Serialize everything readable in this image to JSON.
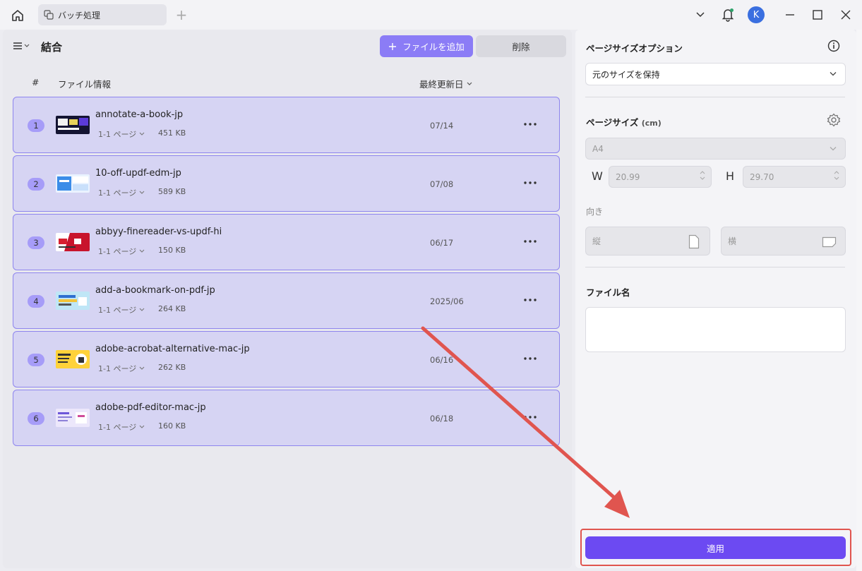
{
  "titlebar": {
    "tab_label": "バッチ処理",
    "avatar_letter": "K"
  },
  "left": {
    "title": "結合",
    "add_file_label": "ファイルを追加",
    "delete_label": "削除",
    "columns": {
      "num": "#",
      "info": "ファイル情報",
      "date": "最終更新日"
    },
    "files": [
      {
        "num": "1",
        "name": "annotate-a-book-jp",
        "pages": "1-1 ページ",
        "size": "451 KB",
        "date": "07/14"
      },
      {
        "num": "2",
        "name": "10-off-updf-edm-jp",
        "pages": "1-1 ページ",
        "size": "589 KB",
        "date": "07/08"
      },
      {
        "num": "3",
        "name": "abbyy-finereader-vs-updf-hi",
        "pages": "1-1 ページ",
        "size": "150 KB",
        "date": "06/17"
      },
      {
        "num": "4",
        "name": "add-a-bookmark-on-pdf-jp",
        "pages": "1-1 ページ",
        "size": "264 KB",
        "date": "2025/06"
      },
      {
        "num": "5",
        "name": "adobe-acrobat-alternative-mac-jp",
        "pages": "1-1 ページ",
        "size": "262 KB",
        "date": "06/16"
      },
      {
        "num": "6",
        "name": "adobe-pdf-editor-mac-jp",
        "pages": "1-1 ページ",
        "size": "160 KB",
        "date": "06/18"
      }
    ]
  },
  "right": {
    "page_size_option_label": "ページサイズオプション",
    "page_size_option_value": "元のサイズを保持",
    "page_size_label": "ページサイズ",
    "page_size_unit": "(cm)",
    "paper_value": "A4",
    "width_letter": "W",
    "width_value": "20.99",
    "height_letter": "H",
    "height_value": "29.70",
    "orientation_label": "向き",
    "portrait_label": "縦",
    "landscape_label": "横",
    "file_name_label": "ファイル名",
    "apply_label": "適用"
  },
  "colors": {
    "accent": "#6c4af2",
    "row_fill": "#d6d4f3",
    "row_border": "#8e85ee",
    "annotation_red": "#e0554f"
  }
}
